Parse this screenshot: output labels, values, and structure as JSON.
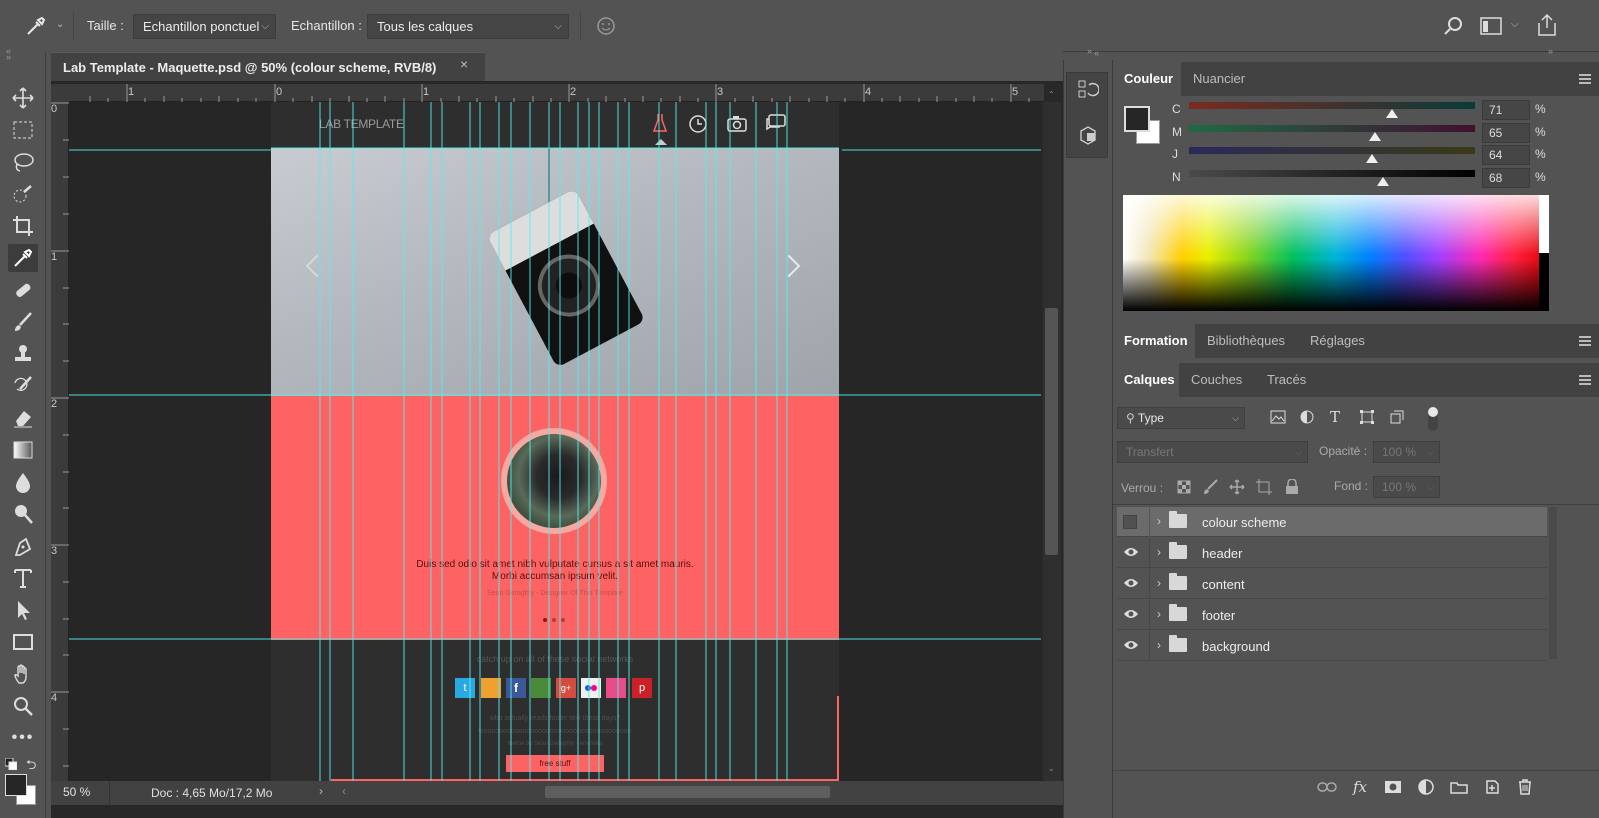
{
  "options_bar": {
    "size_label": "Taille :",
    "size_value": "Echantillon ponctuel",
    "sample_label": "Echantillon :",
    "sample_value": "Tous les calques"
  },
  "document": {
    "tab_title": "Lab Template - Maquette.psd @ 50% (colour scheme, RVB/8)",
    "close_symbol": "×",
    "zoom": "50 %",
    "doc_info": "Doc : 4,65 Mo/17,2 Mo"
  },
  "rulers": {
    "h": [
      "1",
      "0",
      "1",
      "2",
      "3",
      "4",
      "5"
    ],
    "v": [
      "0",
      "1",
      "2",
      "3",
      "4"
    ]
  },
  "mockup": {
    "brand": "LAB TEMPLATE",
    "quote_line1": "Duis sed odio sit amet nibh vulputate cursus a sit amet mauris.",
    "quote_line2": "Morbi accumsan ipsum velit.",
    "author": "Sean Geraghty - Designer Of This Template",
    "social_heading": "catch up on all of these social networks",
    "footer_line1": "who actually reads footer text these days?",
    "footer_line2": "woooooooooooooooooooooooooooooooooooooo",
    "footer_line3": "theme by Sean Geraghty - enemies",
    "cta": "free stuff",
    "colors": {
      "coral": "#fe6363",
      "dark": "#282828",
      "guide": "#52f0f0"
    }
  },
  "color_panel": {
    "tabs": [
      "Couleur",
      "Nuancier"
    ],
    "sliders": [
      {
        "label": "C",
        "value": "71",
        "pct": 71
      },
      {
        "label": "M",
        "value": "65",
        "pct": 65
      },
      {
        "label": "J",
        "value": "64",
        "pct": 64
      },
      {
        "label": "N",
        "value": "68",
        "pct": 68
      }
    ],
    "percent": "%"
  },
  "learn_panel": {
    "tabs": [
      "Formation",
      "Bibliothèques",
      "Réglages"
    ]
  },
  "layers_panel": {
    "tabs": [
      "Calques",
      "Couches",
      "Tracés"
    ],
    "filter_type": "Type",
    "blend_mode": "Transfert",
    "opacity_label": "Opacité :",
    "opacity_value": "100 %",
    "lock_label": "Verrou :",
    "fill_label": "Fond :",
    "fill_value": "100 %",
    "layers": [
      {
        "name": "colour scheme",
        "visible": false,
        "selected": true
      },
      {
        "name": "header",
        "visible": true
      },
      {
        "name": "content",
        "visible": true
      },
      {
        "name": "footer",
        "visible": true
      },
      {
        "name": "background",
        "visible": true
      }
    ]
  }
}
